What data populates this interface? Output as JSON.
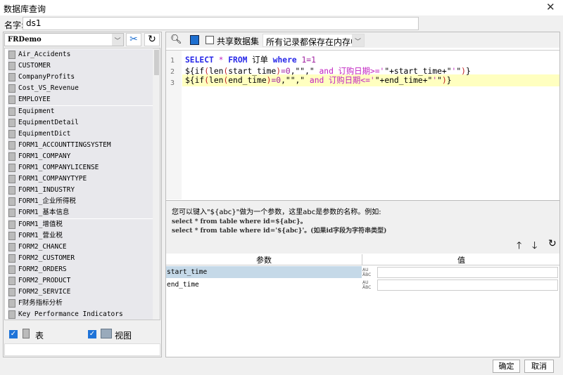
{
  "window": {
    "title": "数据库查询",
    "close": "✕"
  },
  "name": {
    "label": "名字:",
    "value": "ds1"
  },
  "left": {
    "database": "FRDemo",
    "tables": [
      "Air_Accidents",
      "CUSTOMER",
      "CompanyProfits",
      "Cost_VS_Revenue",
      "EMPLOYEE",
      "Equipment",
      "EquipmentDetail",
      "EquipmentDict",
      "FORM1_ACCOUNTTINGSYSTEM",
      "FORM1_COMPANY",
      "FORM1_COMPANYLICENSE",
      "FORM1_COMPANYTYPE",
      "FORM1_INDUSTRY",
      "FORM1_企业所得税",
      "FORM1_基本信息",
      "FORM1_增值税",
      "FORM1_营业税",
      "FORM2_CHANCE",
      "FORM2_CUSTOMER",
      "FORM2_ORDERS",
      "FORM2_PRODUCT",
      "FORM2_SERVICE",
      "F财务指标分析",
      "Key Performance Indicators"
    ],
    "show_tables": {
      "label": "表",
      "checked": true
    },
    "show_views": {
      "label": "视图",
      "checked": true
    }
  },
  "toolbar": {
    "share_label": "共享数据集",
    "share_checked": false,
    "cache_mode": "所有记录都保存在内存中"
  },
  "editor": {
    "line_numbers": [
      "1",
      "2",
      "3"
    ]
  },
  "hint": {
    "line1": "您可以键入\"${abc}\"做为一个参数，这里abc是参数的名称。例如:",
    "line2": "select * from table where id=${abc}。",
    "line3": "select * from table where id='${abc}'。(如果id字段为字符串类型)"
  },
  "params": {
    "headers": [
      "参数",
      "值"
    ],
    "rows": [
      {
        "name": "start_time",
        "value": ""
      },
      {
        "name": "end_time",
        "value": ""
      }
    ],
    "type_icon": "A̲U ABC"
  },
  "footer": {
    "ok": "确定",
    "cancel": "取消"
  }
}
